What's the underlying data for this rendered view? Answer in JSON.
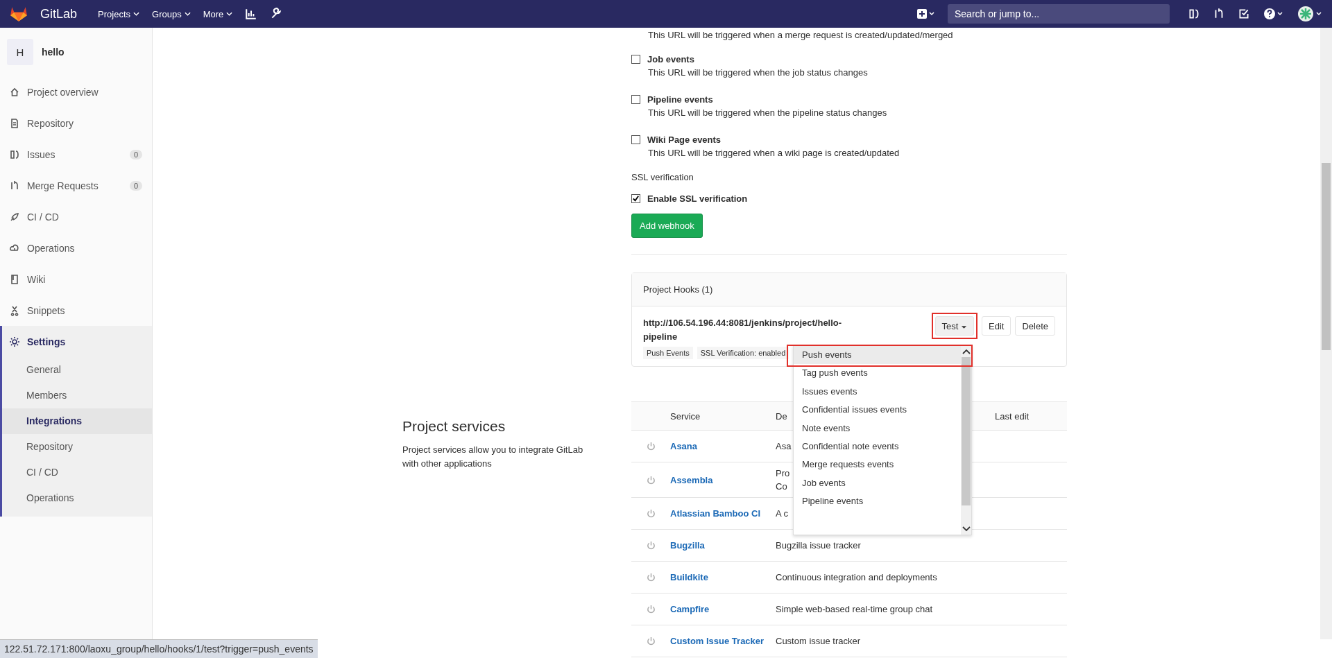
{
  "nav": {
    "brand": "GitLab",
    "menus": [
      {
        "label": "Projects"
      },
      {
        "label": "Groups"
      },
      {
        "label": "More"
      }
    ],
    "search": {
      "placeholder": "Search or jump to..."
    }
  },
  "sidebar": {
    "project": {
      "avatar": "H",
      "name": "hello"
    },
    "items": [
      {
        "label": "Project overview",
        "selected": false
      },
      {
        "label": "Repository",
        "selected": false
      },
      {
        "label": "Issues",
        "count": "0",
        "selected": false
      },
      {
        "label": "Merge Requests",
        "count": "0",
        "selected": false
      },
      {
        "label": "CI / CD",
        "selected": false
      },
      {
        "label": "Operations",
        "selected": false
      },
      {
        "label": "Wiki",
        "selected": false
      },
      {
        "label": "Snippets",
        "selected": false
      },
      {
        "label": "Settings",
        "selected": true,
        "expanded": true,
        "children": [
          {
            "label": "General",
            "selected": false
          },
          {
            "label": "Members",
            "selected": false
          },
          {
            "label": "Integrations",
            "selected": true
          },
          {
            "label": "Repository",
            "selected": false
          },
          {
            "label": "CI / CD",
            "selected": false
          },
          {
            "label": "Operations",
            "selected": false
          }
        ]
      }
    ]
  },
  "webhook_form": {
    "cut_text": "This URL will be triggered when a merge request is created/updated/merged",
    "events": [
      {
        "label": "Job events",
        "description": "This URL will be triggered when the job status changes",
        "checked": false
      },
      {
        "label": "Pipeline events",
        "description": "This URL will be triggered when the pipeline status changes",
        "checked": false
      },
      {
        "label": "Wiki Page events",
        "description": "This URL will be triggered when a wiki page is created/updated",
        "checked": false
      }
    ],
    "ssl": {
      "heading": "SSL verification",
      "label": "Enable SSL verification",
      "checked": true
    },
    "submit": "Add webhook"
  },
  "project_hooks": {
    "title": "Project Hooks (1)",
    "hooks": [
      {
        "url": "http://106.54.196.44:8081/jenkins/project/hello-pipeline",
        "tags": [
          "Push Events",
          "SSL Verification: enabled"
        ],
        "test_button": {
          "label": "Test",
          "highlighted": true
        },
        "buttons": [
          "Edit",
          "Delete"
        ]
      }
    ],
    "test_menu": {
      "items": [
        {
          "label": "Push events",
          "selected": true,
          "highlighted": true
        },
        {
          "label": "Tag push events",
          "selected": false,
          "highlighted": false
        },
        {
          "label": "Issues events",
          "selected": false,
          "highlighted": false
        },
        {
          "label": "Confidential issues events",
          "selected": false,
          "highlighted": false
        },
        {
          "label": "Note events",
          "selected": false,
          "highlighted": false
        },
        {
          "label": "Confidential note events",
          "selected": false,
          "highlighted": false
        },
        {
          "label": "Merge requests events",
          "selected": false,
          "highlighted": false
        },
        {
          "label": "Job events",
          "selected": false,
          "highlighted": false
        },
        {
          "label": "Pipeline events",
          "selected": false,
          "highlighted": false
        }
      ]
    }
  },
  "project_services": {
    "title": "Project services",
    "description": "Project services allow you to integrate GitLab with other applications",
    "table": {
      "columns": [
        "Service",
        "De",
        "Last edit"
      ],
      "rows": [
        {
          "service": "Asana",
          "description": "Asa"
        },
        {
          "service": "Assembla",
          "description": "Pro\nCo"
        },
        {
          "service": "Atlassian Bamboo CI",
          "description": "A c"
        },
        {
          "service": "Bugzilla",
          "description": "Bugzilla issue tracker"
        },
        {
          "service": "Buildkite",
          "description": "Continuous integration and deployments"
        },
        {
          "service": "Campfire",
          "description": "Simple web-based real-time group chat"
        },
        {
          "service": "Custom Issue Tracker",
          "description": "Custom issue tracker"
        }
      ]
    }
  },
  "status_bar": {
    "url": "122.51.72.171:800/laoxu_group/hello/hooks/1/test?trigger=push_events"
  }
}
